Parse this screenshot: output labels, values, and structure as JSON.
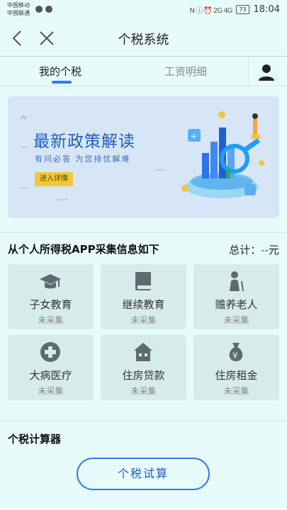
{
  "status_bar": {
    "carrier1": "中国移动",
    "carrier2": "中国联通",
    "signal_text": "N ⓘ ⏰ 2G 4G",
    "battery": "73",
    "time": "18:04"
  },
  "nav": {
    "title": "个税系统"
  },
  "tabs": [
    {
      "label": "我的个税",
      "active": true
    },
    {
      "label": "工资明细",
      "active": false
    }
  ],
  "banner": {
    "title": "最新政策解读",
    "subtitle": "有问必答  为您排忧解难",
    "button_label": "进入详情",
    "accent_color": "#1f5fbf",
    "button_color": "#f1c73a"
  },
  "collect": {
    "title": "从个人所得税APP采集信息如下",
    "total_label": "总计：",
    "total_value": "--",
    "total_unit": "元",
    "items": [
      {
        "label": "子女教育",
        "status": "未采集",
        "icon": "graduation-cap-icon"
      },
      {
        "label": "继续教育",
        "status": "未采集",
        "icon": "book-icon"
      },
      {
        "label": "赡养老人",
        "status": "未采集",
        "icon": "elderly-person-icon"
      },
      {
        "label": "大病医疗",
        "status": "未采集",
        "icon": "medical-cross-icon"
      },
      {
        "label": "住房贷款",
        "status": "未采集",
        "icon": "house-icon"
      },
      {
        "label": "住房租金",
        "status": "未采集",
        "icon": "money-bag-icon"
      }
    ]
  },
  "calculator": {
    "title": "个税计算器",
    "button_label": "个税试算"
  }
}
